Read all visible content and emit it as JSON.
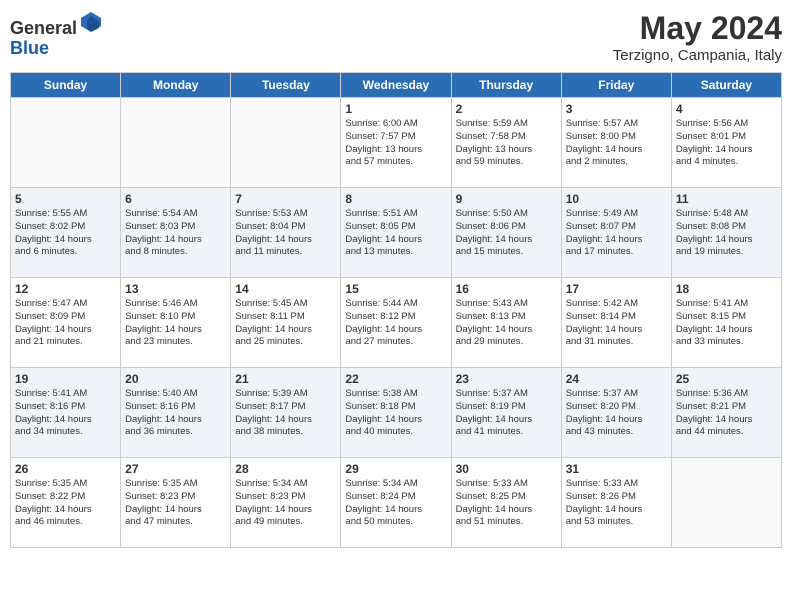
{
  "header": {
    "logo_line1": "General",
    "logo_line2": "Blue",
    "month": "May 2024",
    "location": "Terzigno, Campania, Italy"
  },
  "weekdays": [
    "Sunday",
    "Monday",
    "Tuesday",
    "Wednesday",
    "Thursday",
    "Friday",
    "Saturday"
  ],
  "weeks": [
    [
      {
        "day": "",
        "info": ""
      },
      {
        "day": "",
        "info": ""
      },
      {
        "day": "",
        "info": ""
      },
      {
        "day": "1",
        "info": "Sunrise: 6:00 AM\nSunset: 7:57 PM\nDaylight: 13 hours\nand 57 minutes."
      },
      {
        "day": "2",
        "info": "Sunrise: 5:59 AM\nSunset: 7:58 PM\nDaylight: 13 hours\nand 59 minutes."
      },
      {
        "day": "3",
        "info": "Sunrise: 5:57 AM\nSunset: 8:00 PM\nDaylight: 14 hours\nand 2 minutes."
      },
      {
        "day": "4",
        "info": "Sunrise: 5:56 AM\nSunset: 8:01 PM\nDaylight: 14 hours\nand 4 minutes."
      }
    ],
    [
      {
        "day": "5",
        "info": "Sunrise: 5:55 AM\nSunset: 8:02 PM\nDaylight: 14 hours\nand 6 minutes."
      },
      {
        "day": "6",
        "info": "Sunrise: 5:54 AM\nSunset: 8:03 PM\nDaylight: 14 hours\nand 8 minutes."
      },
      {
        "day": "7",
        "info": "Sunrise: 5:53 AM\nSunset: 8:04 PM\nDaylight: 14 hours\nand 11 minutes."
      },
      {
        "day": "8",
        "info": "Sunrise: 5:51 AM\nSunset: 8:05 PM\nDaylight: 14 hours\nand 13 minutes."
      },
      {
        "day": "9",
        "info": "Sunrise: 5:50 AM\nSunset: 8:06 PM\nDaylight: 14 hours\nand 15 minutes."
      },
      {
        "day": "10",
        "info": "Sunrise: 5:49 AM\nSunset: 8:07 PM\nDaylight: 14 hours\nand 17 minutes."
      },
      {
        "day": "11",
        "info": "Sunrise: 5:48 AM\nSunset: 8:08 PM\nDaylight: 14 hours\nand 19 minutes."
      }
    ],
    [
      {
        "day": "12",
        "info": "Sunrise: 5:47 AM\nSunset: 8:09 PM\nDaylight: 14 hours\nand 21 minutes."
      },
      {
        "day": "13",
        "info": "Sunrise: 5:46 AM\nSunset: 8:10 PM\nDaylight: 14 hours\nand 23 minutes."
      },
      {
        "day": "14",
        "info": "Sunrise: 5:45 AM\nSunset: 8:11 PM\nDaylight: 14 hours\nand 25 minutes."
      },
      {
        "day": "15",
        "info": "Sunrise: 5:44 AM\nSunset: 8:12 PM\nDaylight: 14 hours\nand 27 minutes."
      },
      {
        "day": "16",
        "info": "Sunrise: 5:43 AM\nSunset: 8:13 PM\nDaylight: 14 hours\nand 29 minutes."
      },
      {
        "day": "17",
        "info": "Sunrise: 5:42 AM\nSunset: 8:14 PM\nDaylight: 14 hours\nand 31 minutes."
      },
      {
        "day": "18",
        "info": "Sunrise: 5:41 AM\nSunset: 8:15 PM\nDaylight: 14 hours\nand 33 minutes."
      }
    ],
    [
      {
        "day": "19",
        "info": "Sunrise: 5:41 AM\nSunset: 8:16 PM\nDaylight: 14 hours\nand 34 minutes."
      },
      {
        "day": "20",
        "info": "Sunrise: 5:40 AM\nSunset: 8:16 PM\nDaylight: 14 hours\nand 36 minutes."
      },
      {
        "day": "21",
        "info": "Sunrise: 5:39 AM\nSunset: 8:17 PM\nDaylight: 14 hours\nand 38 minutes."
      },
      {
        "day": "22",
        "info": "Sunrise: 5:38 AM\nSunset: 8:18 PM\nDaylight: 14 hours\nand 40 minutes."
      },
      {
        "day": "23",
        "info": "Sunrise: 5:37 AM\nSunset: 8:19 PM\nDaylight: 14 hours\nand 41 minutes."
      },
      {
        "day": "24",
        "info": "Sunrise: 5:37 AM\nSunset: 8:20 PM\nDaylight: 14 hours\nand 43 minutes."
      },
      {
        "day": "25",
        "info": "Sunrise: 5:36 AM\nSunset: 8:21 PM\nDaylight: 14 hours\nand 44 minutes."
      }
    ],
    [
      {
        "day": "26",
        "info": "Sunrise: 5:35 AM\nSunset: 8:22 PM\nDaylight: 14 hours\nand 46 minutes."
      },
      {
        "day": "27",
        "info": "Sunrise: 5:35 AM\nSunset: 8:23 PM\nDaylight: 14 hours\nand 47 minutes."
      },
      {
        "day": "28",
        "info": "Sunrise: 5:34 AM\nSunset: 8:23 PM\nDaylight: 14 hours\nand 49 minutes."
      },
      {
        "day": "29",
        "info": "Sunrise: 5:34 AM\nSunset: 8:24 PM\nDaylight: 14 hours\nand 50 minutes."
      },
      {
        "day": "30",
        "info": "Sunrise: 5:33 AM\nSunset: 8:25 PM\nDaylight: 14 hours\nand 51 minutes."
      },
      {
        "day": "31",
        "info": "Sunrise: 5:33 AM\nSunset: 8:26 PM\nDaylight: 14 hours\nand 53 minutes."
      },
      {
        "day": "",
        "info": ""
      }
    ]
  ]
}
